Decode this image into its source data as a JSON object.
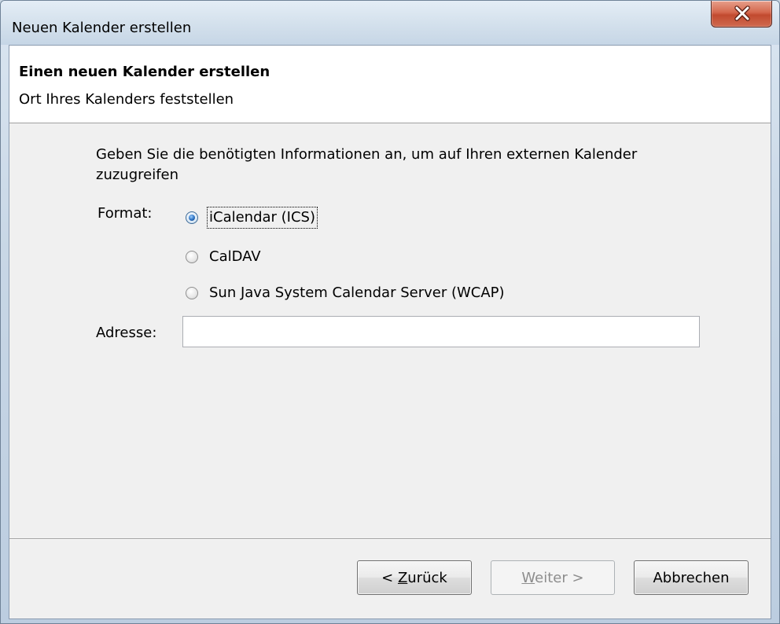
{
  "window": {
    "title": "Neuen Kalender erstellen",
    "close_icon": "close-x-icon"
  },
  "header": {
    "title": "Einen neuen Kalender erstellen",
    "subtitle": "Ort Ihres Kalenders feststellen"
  },
  "form": {
    "instructions": "Geben Sie die benötigten Informationen an, um auf Ihren externen Kalender zuzugreifen",
    "format_label": "Format:",
    "format_options": [
      {
        "label": "iCalendar (ICS)",
        "checked": true
      },
      {
        "label": "CalDAV",
        "checked": false
      },
      {
        "label": "Sun Java System Calendar Server (WCAP)",
        "checked": false
      }
    ],
    "address_label": "Adresse:",
    "address_value": "",
    "address_placeholder": ""
  },
  "buttons": {
    "back": {
      "prefix": "< ",
      "accel": "Z",
      "rest": "urück",
      "enabled": true
    },
    "next": {
      "prefix": "",
      "accel": "W",
      "rest": "eiter >",
      "enabled": false
    },
    "cancel": {
      "label": "Abbrechen",
      "enabled": true
    }
  },
  "colors": {
    "close_button": "#c24a2f",
    "checked_radio": "#2a6fc0",
    "disabled_text": "#8d8d8d"
  }
}
